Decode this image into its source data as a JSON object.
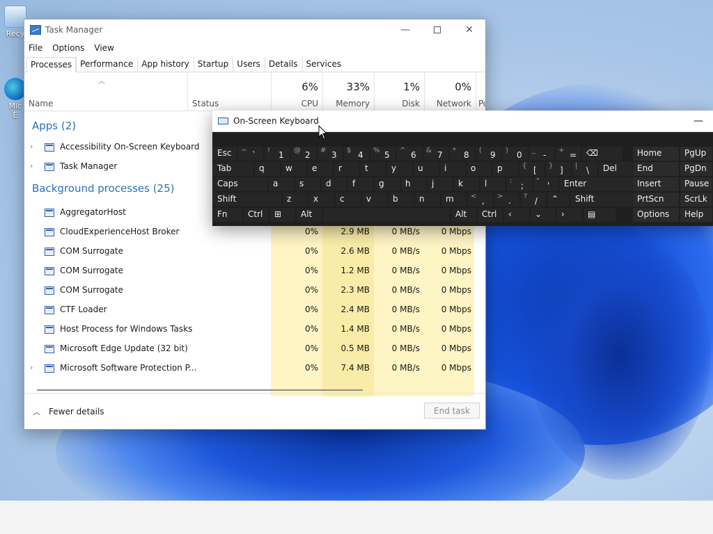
{
  "desktop": {
    "icons": [
      {
        "label": "Recy",
        "icon": "recycle-bin-icon"
      },
      {
        "label": "Mic",
        "label2": "E",
        "icon": "edge-shortcut-icon"
      }
    ]
  },
  "taskmanager": {
    "title": "Task Manager",
    "menu": [
      "File",
      "Options",
      "View"
    ],
    "tabs": [
      "Processes",
      "Performance",
      "App history",
      "Startup",
      "Users",
      "Details",
      "Services"
    ],
    "active_tab": "Processes",
    "columns": {
      "name": "Name",
      "status": "Status",
      "cpu": {
        "pct": "6%",
        "label": "CPU"
      },
      "memory": {
        "pct": "33%",
        "label": "Memory"
      },
      "disk": {
        "pct": "1%",
        "label": "Disk"
      },
      "network": {
        "pct": "0%",
        "label": "Network"
      },
      "power": "Po"
    },
    "apps_header": "Apps (2)",
    "apps": [
      {
        "name": "Accessibility On-Screen Keyboard",
        "icon": "keyboard-icon"
      },
      {
        "name": "Task Manager",
        "icon": "task-manager-icon"
      }
    ],
    "bg_header": "Background processes (25)",
    "background": [
      {
        "name": "AggregatorHost",
        "cpu": "",
        "mem": "",
        "disk": "",
        "net": ""
      },
      {
        "name": "CloudExperienceHost Broker",
        "cpu": "0%",
        "mem": "2.9 MB",
        "disk": "0 MB/s",
        "net": "0 Mbps"
      },
      {
        "name": "COM Surrogate",
        "cpu": "0%",
        "mem": "2.6 MB",
        "disk": "0 MB/s",
        "net": "0 Mbps"
      },
      {
        "name": "COM Surrogate",
        "cpu": "0%",
        "mem": "1.2 MB",
        "disk": "0 MB/s",
        "net": "0 Mbps"
      },
      {
        "name": "COM Surrogate",
        "cpu": "0%",
        "mem": "2.3 MB",
        "disk": "0 MB/s",
        "net": "0 Mbps"
      },
      {
        "name": "CTF Loader",
        "cpu": "0%",
        "mem": "2.4 MB",
        "disk": "0 MB/s",
        "net": "0 Mbps"
      },
      {
        "name": "Host Process for Windows Tasks",
        "cpu": "0%",
        "mem": "1.4 MB",
        "disk": "0 MB/s",
        "net": "0 Mbps"
      },
      {
        "name": "Microsoft Edge Update (32 bit)",
        "cpu": "0%",
        "mem": "0.5 MB",
        "disk": "0 MB/s",
        "net": "0 Mbps"
      },
      {
        "name": "Microsoft Software Protection P...",
        "cpu": "0%",
        "mem": "7.4 MB",
        "disk": "0 MB/s",
        "net": "0 Mbps"
      }
    ],
    "fewer_details": "Fewer details",
    "end_task": "End task"
  },
  "osk": {
    "title": "On-Screen Keyboard",
    "rows": [
      [
        {
          "main": "Esc",
          "w": 1
        },
        {
          "shift": "~",
          "main": "`"
        },
        {
          "shift": "!",
          "main": "1"
        },
        {
          "shift": "@",
          "main": "2"
        },
        {
          "shift": "#",
          "main": "3"
        },
        {
          "shift": "$",
          "main": "4"
        },
        {
          "shift": "%",
          "main": "5"
        },
        {
          "shift": "^",
          "main": "6"
        },
        {
          "shift": "&",
          "main": "7"
        },
        {
          "shift": "*",
          "main": "8"
        },
        {
          "shift": "(",
          "main": "9"
        },
        {
          "shift": ")",
          "main": "0"
        },
        {
          "shift": "_",
          "main": "-"
        },
        {
          "shift": "+",
          "main": "="
        },
        {
          "main": "⌫"
        }
      ],
      [
        {
          "main": "Tab"
        },
        {
          "main": "q"
        },
        {
          "main": "w"
        },
        {
          "main": "e"
        },
        {
          "main": "r"
        },
        {
          "main": "t"
        },
        {
          "main": "y"
        },
        {
          "main": "u"
        },
        {
          "main": "i"
        },
        {
          "main": "o"
        },
        {
          "main": "p"
        },
        {
          "shift": "{",
          "main": "["
        },
        {
          "shift": "}",
          "main": "]"
        },
        {
          "shift": "|",
          "main": "\\"
        },
        {
          "main": "Del"
        }
      ],
      [
        {
          "main": "Caps"
        },
        {
          "main": "a"
        },
        {
          "main": "s"
        },
        {
          "main": "d"
        },
        {
          "main": "f"
        },
        {
          "main": "g"
        },
        {
          "main": "h"
        },
        {
          "main": "j"
        },
        {
          "main": "k"
        },
        {
          "main": "l"
        },
        {
          "shift": ":",
          "main": ";"
        },
        {
          "shift": "\"",
          "main": "'"
        },
        {
          "main": "Enter"
        }
      ],
      [
        {
          "main": "Shift"
        },
        {
          "main": "z"
        },
        {
          "main": "x"
        },
        {
          "main": "c"
        },
        {
          "main": "v"
        },
        {
          "main": "b"
        },
        {
          "main": "n"
        },
        {
          "main": "m"
        },
        {
          "shift": "<",
          "main": ","
        },
        {
          "shift": ">",
          "main": "."
        },
        {
          "shift": "?",
          "main": "/"
        },
        {
          "main": "⌃"
        },
        {
          "main": "Shift"
        }
      ],
      [
        {
          "main": "Fn"
        },
        {
          "main": "Ctrl"
        },
        {
          "main": "⊞"
        },
        {
          "main": "Alt"
        },
        {
          "main": ""
        },
        {
          "main": "Alt"
        },
        {
          "main": "Ctrl"
        },
        {
          "main": "‹"
        },
        {
          "main": "⌄"
        },
        {
          "main": "›"
        },
        {
          "main": "▤"
        }
      ]
    ],
    "nav": [
      [
        "Home",
        "PgUp"
      ],
      [
        "End",
        "PgDn"
      ],
      [
        "Insert",
        "Pause"
      ],
      [
        "PrtScn",
        "ScrLk"
      ],
      [
        "Options",
        "Help"
      ]
    ]
  },
  "colors": {
    "accent": "#2b6fbf",
    "heat_light": "#fff4c4",
    "heat_medium": "#f9eca8"
  }
}
